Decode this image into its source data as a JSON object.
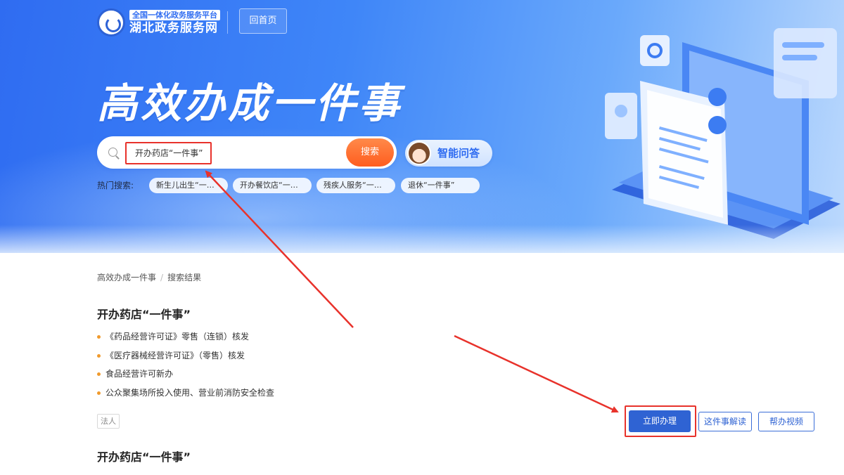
{
  "header": {
    "platform_subtitle": "全国一体化政务服务平台",
    "site_name": "湖北政务服务网",
    "home_button": "回首页"
  },
  "hero": {
    "title": "高效办成一件事",
    "search": {
      "value": "开办药店“一件事”",
      "button_label": "搜索",
      "icon": "search-icon"
    },
    "ai_assistant_label": "智能问答",
    "hot_search": {
      "label": "热门搜索:",
      "tags": [
        "新生儿出生“一…",
        "开办餐饮店“一…",
        "残疾人服务“一…",
        "退休“一件事”"
      ]
    }
  },
  "breadcrumb": {
    "items": [
      "高效办成一件事",
      "搜索结果"
    ],
    "separator": "/"
  },
  "results": [
    {
      "title": "开办药店“一件事”",
      "items": [
        "《药品经营许可证》零售（连锁）核发",
        "《医疗器械经营许可证》（零售）核发",
        "食品经营许可新办",
        "公众聚集场所投入使用、营业前消防安全检查"
      ],
      "tag": "法人",
      "actions": {
        "apply": "立即办理",
        "explain": "这件事解读",
        "video": "帮办视频"
      }
    },
    {
      "title": "开办药店“一件事”"
    }
  ],
  "colors": {
    "hero_blue": "#3f86f8",
    "search_button": "#ff6a2b",
    "primary_button": "#2f63d3",
    "bullet": "#f09a2d",
    "annotation_red": "#e8322b"
  }
}
